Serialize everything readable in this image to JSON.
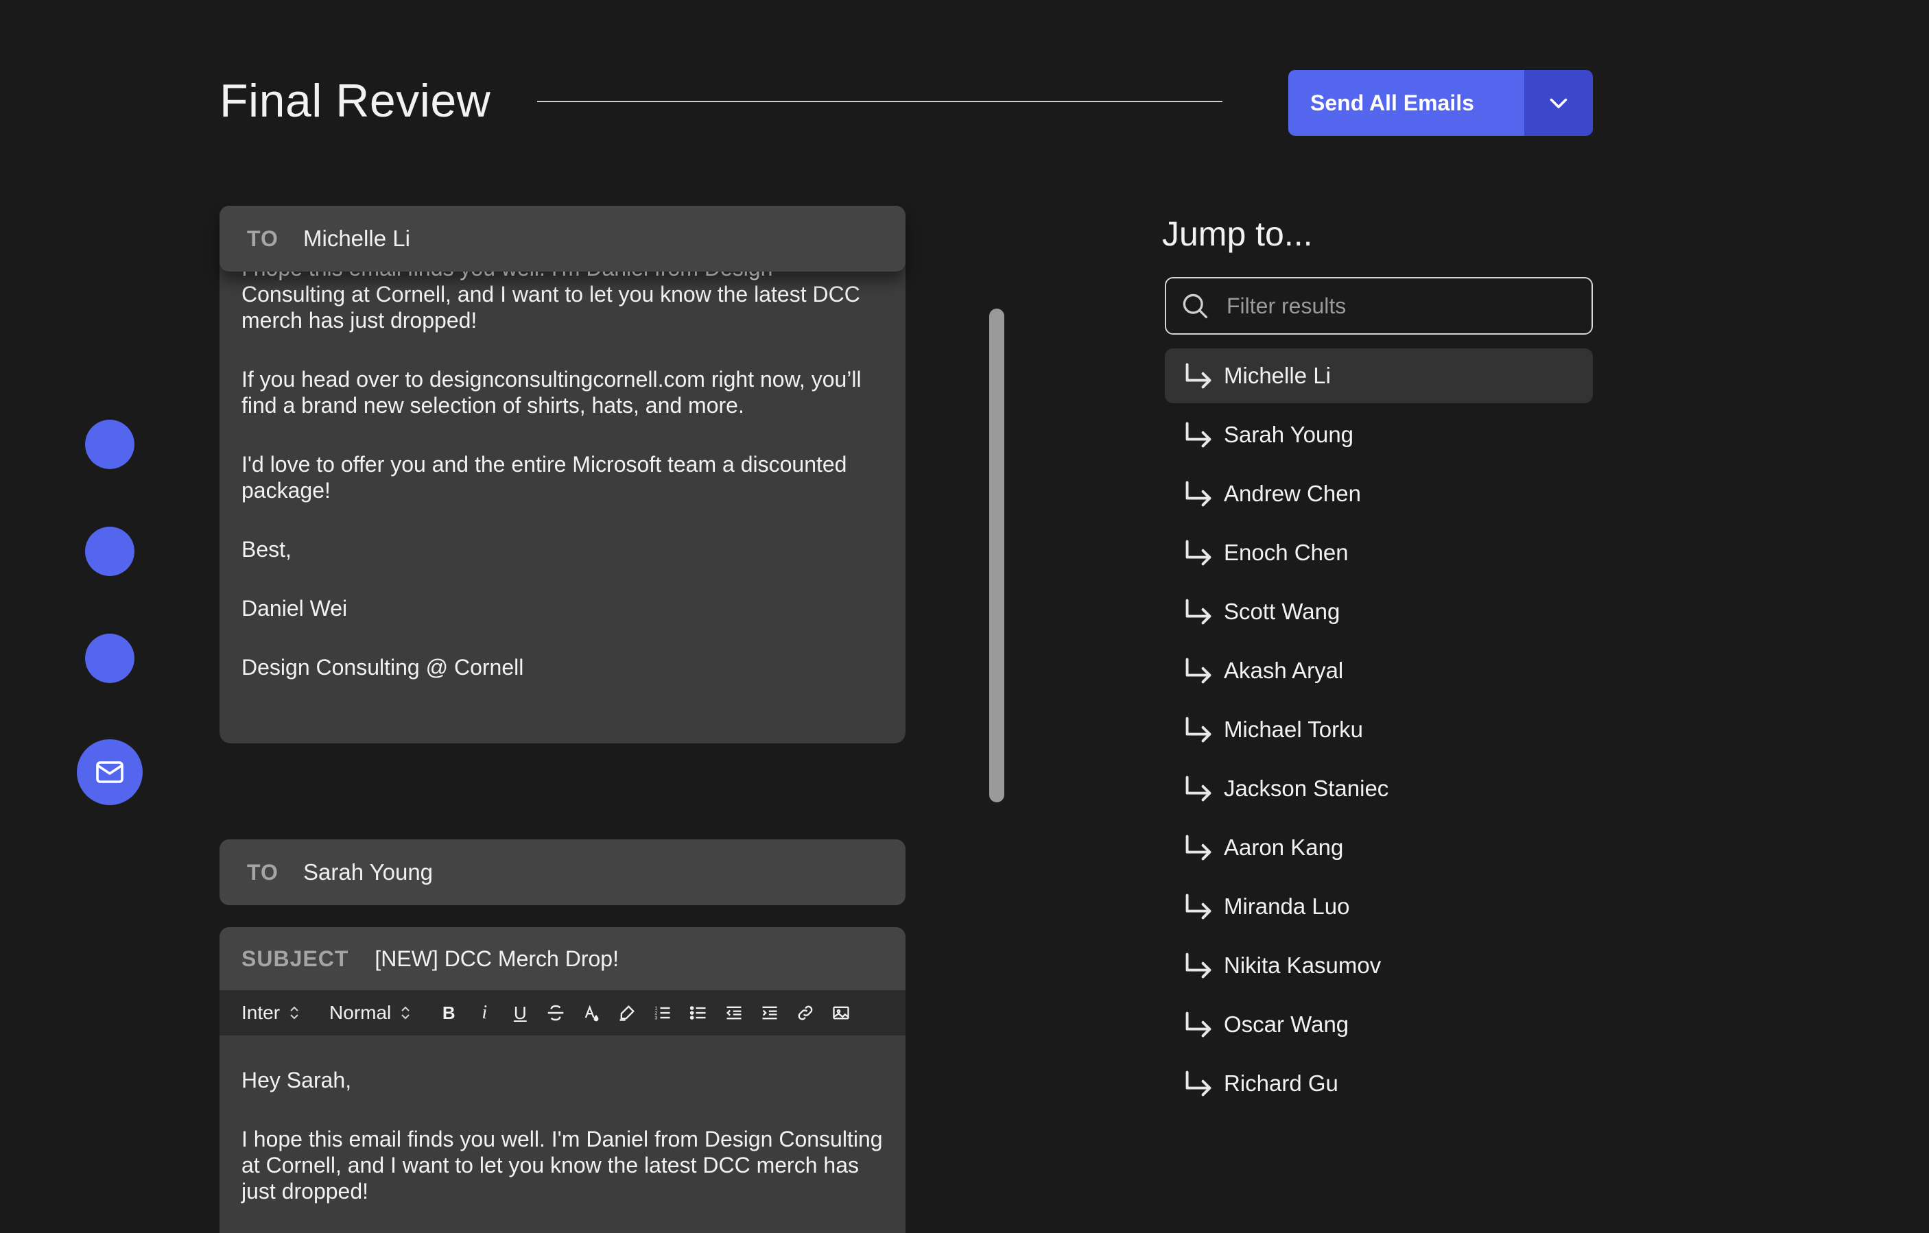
{
  "header": {
    "title": "Final Review",
    "send_label": "Send All Emails"
  },
  "colors": {
    "accent": "#5465ee",
    "accent_dark": "#3c48cc",
    "background": "#1a1a1a",
    "card": "#3d3d3d"
  },
  "emails": [
    {
      "to_label": "TO",
      "to_name": "Michelle Li",
      "partial_line": "I hope this email finds you well. I'm Daniel from Design",
      "paragraphs": [
        "Consulting at Cornell, and I want to let you know the latest DCC merch has just dropped!",
        "If you head over to designconsultingcornell.com right now, you’ll find a brand new selection of shirts, hats, and more.",
        "I'd love to offer you and the entire Microsoft team a discounted package!",
        "Best,",
        "Daniel Wei",
        "Design Consulting @ Cornell"
      ]
    },
    {
      "to_label": "TO",
      "to_name": "Sarah Young",
      "subject_label": "SUBJECT",
      "subject": "[NEW] DCC Merch Drop!",
      "font_select": "Inter",
      "size_select": "Normal",
      "paragraphs": [
        "Hey Sarah,",
        "I hope this email finds you well. I'm Daniel from Design Consulting at Cornell, and I want to let you know the latest DCC merch has just dropped!"
      ]
    }
  ],
  "toolbar_icons": [
    "bold-icon",
    "italic-icon",
    "underline-icon",
    "strikethrough-icon",
    "text-color-icon",
    "highlight-icon",
    "ordered-list-icon",
    "bullet-list-icon",
    "outdent-icon",
    "indent-icon",
    "link-icon",
    "image-icon"
  ],
  "jump": {
    "title": "Jump to...",
    "filter_placeholder": "Filter results",
    "items": [
      "Michelle Li",
      "Sarah Young",
      "Andrew Chen",
      "Enoch Chen",
      "Scott Wang",
      "Akash Aryal",
      "Michael Torku",
      "Jackson Staniec",
      "Aaron Kang",
      "Miranda Luo",
      "Nikita Kasumov",
      "Oscar Wang",
      "Richard Gu"
    ],
    "active_index": 0
  }
}
